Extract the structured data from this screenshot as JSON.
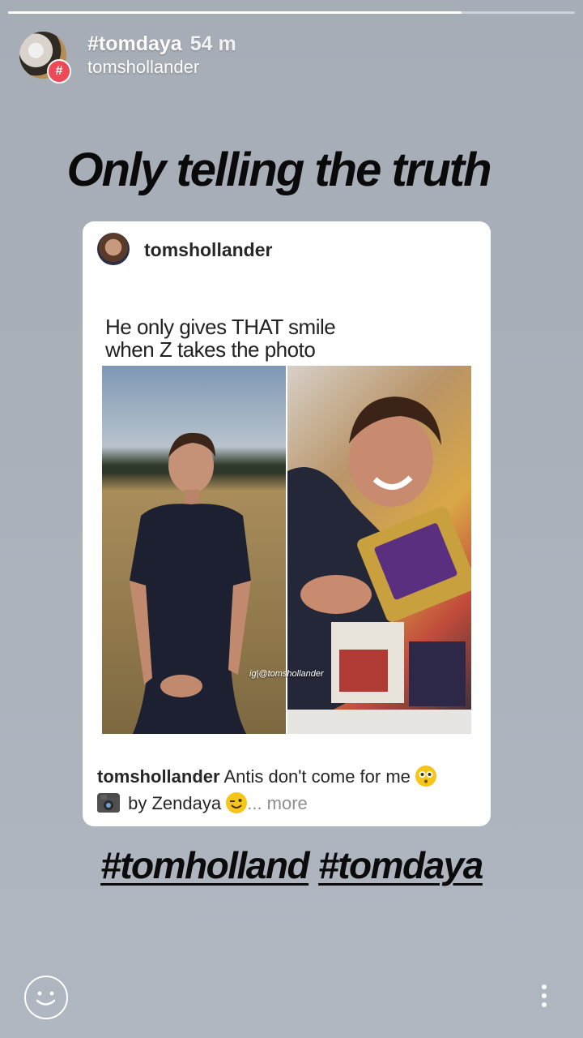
{
  "story": {
    "progress_fraction": 0.8,
    "header": {
      "hashtag": "#tomdaya",
      "time": "54 m",
      "username": "tomshollander",
      "badge_symbol": "#"
    },
    "headline": "Only telling the truth",
    "post": {
      "username": "tomshollander",
      "image_caption_line1": "He only gives THAT smile",
      "image_caption_line2": "when Z takes the photo",
      "watermark": "ig|@tomshollander",
      "caption_user": "tomshollander",
      "caption_text1": "Antis don't come for me",
      "caption_text2": "by Zendaya",
      "more": "... more"
    },
    "hashtag_one": "#tomholland",
    "hashtag_two": "#tomdaya",
    "icons": [
      "hashtag-badge-icon",
      "smiley-icon",
      "more-options-icon",
      "flushed-emoji-icon",
      "camera-emoji-icon",
      "wink-emoji-icon"
    ],
    "colors": {
      "badge": "#ed4956",
      "background": "#abb1ba"
    }
  }
}
